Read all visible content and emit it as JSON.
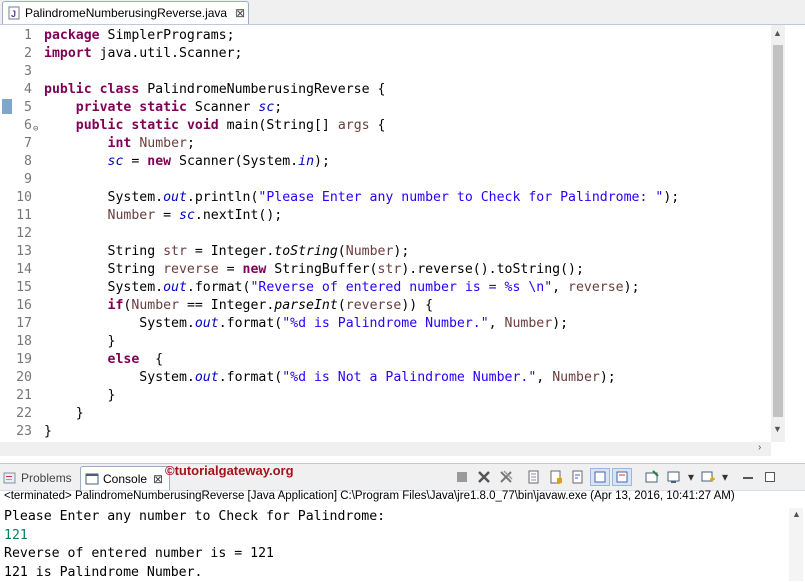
{
  "editor_tab": {
    "title": "PalindromeNumberusingReverse.java",
    "close_glyph": "⊠",
    "icon": "java-file-icon"
  },
  "code_lines": [
    {
      "n": "1",
      "parts": [
        [
          "kw",
          "package"
        ],
        [
          "",
          " SimplerPrograms;"
        ]
      ]
    },
    {
      "n": "2",
      "parts": [
        [
          "kw",
          "import"
        ],
        [
          "",
          " java.util.Scanner;"
        ]
      ]
    },
    {
      "n": "3",
      "parts": []
    },
    {
      "n": "4",
      "parts": [
        [
          "kw",
          "public"
        ],
        [
          "",
          " "
        ],
        [
          "kw",
          "class"
        ],
        [
          "",
          " PalindromeNumberusingReverse {"
        ]
      ]
    },
    {
      "n": "5",
      "parts": [
        [
          "",
          "    "
        ],
        [
          "kw",
          "private"
        ],
        [
          "",
          " "
        ],
        [
          "kw",
          "static"
        ],
        [
          "",
          " Scanner "
        ],
        [
          "sfld",
          "sc"
        ],
        [
          "",
          ";"
        ]
      ]
    },
    {
      "n": "6",
      "parts": [
        [
          "",
          "    "
        ],
        [
          "kw",
          "public"
        ],
        [
          "",
          " "
        ],
        [
          "kw",
          "static"
        ],
        [
          "",
          " "
        ],
        [
          "kw",
          "void"
        ],
        [
          "",
          " main(String[] "
        ],
        [
          "var",
          "args"
        ],
        [
          "",
          " {"
        ]
      ]
    },
    {
      "n": "7",
      "parts": [
        [
          "",
          "        "
        ],
        [
          "kw",
          "int"
        ],
        [
          "",
          " "
        ],
        [
          "var",
          "Number"
        ],
        [
          "",
          ";"
        ]
      ]
    },
    {
      "n": "8",
      "parts": [
        [
          "",
          "        "
        ],
        [
          "sfld",
          "sc"
        ],
        [
          "",
          " = "
        ],
        [
          "kw",
          "new"
        ],
        [
          "",
          " Scanner(System."
        ],
        [
          "sfld",
          "in"
        ],
        [
          "",
          ");"
        ]
      ]
    },
    {
      "n": "9",
      "parts": []
    },
    {
      "n": "10",
      "parts": [
        [
          "",
          "        System."
        ],
        [
          "sfld",
          "out"
        ],
        [
          "",
          ".println("
        ],
        [
          "str",
          "\"Please Enter any number to Check for Palindrome: \""
        ],
        [
          "",
          ");"
        ]
      ]
    },
    {
      "n": "11",
      "parts": [
        [
          "",
          "        "
        ],
        [
          "var",
          "Number"
        ],
        [
          "",
          " = "
        ],
        [
          "sfld",
          "sc"
        ],
        [
          "",
          ".nextInt();"
        ]
      ]
    },
    {
      "n": "12",
      "parts": []
    },
    {
      "n": "13",
      "parts": [
        [
          "",
          "        String "
        ],
        [
          "var",
          "str"
        ],
        [
          "",
          " = Integer."
        ],
        [
          "smeth",
          "toString"
        ],
        [
          "",
          "("
        ],
        [
          "var",
          "Number"
        ],
        [
          "",
          ");"
        ]
      ]
    },
    {
      "n": "14",
      "parts": [
        [
          "",
          "        String "
        ],
        [
          "var",
          "reverse"
        ],
        [
          "",
          " = "
        ],
        [
          "kw",
          "new"
        ],
        [
          "",
          " StringBuffer("
        ],
        [
          "var",
          "str"
        ],
        [
          "",
          ").reverse().toString();"
        ]
      ]
    },
    {
      "n": "15",
      "parts": [
        [
          "",
          "        System."
        ],
        [
          "sfld",
          "out"
        ],
        [
          "",
          ".format("
        ],
        [
          "str",
          "\"Reverse of entered number is = %s \\n\""
        ],
        [
          "",
          ", "
        ],
        [
          "var",
          "reverse"
        ],
        [
          "",
          ");"
        ]
      ]
    },
    {
      "n": "16",
      "parts": [
        [
          "",
          "        "
        ],
        [
          "kw",
          "if"
        ],
        [
          "",
          "("
        ],
        [
          "var",
          "Number"
        ],
        [
          "",
          " == Integer."
        ],
        [
          "smeth",
          "parseInt"
        ],
        [
          "",
          "("
        ],
        [
          "var",
          "reverse"
        ],
        [
          "",
          ")) {"
        ]
      ]
    },
    {
      "n": "17",
      "parts": [
        [
          "",
          "            System."
        ],
        [
          "sfld",
          "out"
        ],
        [
          "",
          ".format("
        ],
        [
          "str",
          "\"%d is Palindrome Number.\""
        ],
        [
          "",
          ", "
        ],
        [
          "var",
          "Number"
        ],
        [
          "",
          ");"
        ]
      ]
    },
    {
      "n": "18",
      "parts": [
        [
          "",
          "        }"
        ]
      ]
    },
    {
      "n": "19",
      "parts": [
        [
          "",
          "        "
        ],
        [
          "kw",
          "else"
        ],
        [
          "",
          "  {"
        ]
      ]
    },
    {
      "n": "20",
      "parts": [
        [
          "",
          "            System."
        ],
        [
          "sfld",
          "out"
        ],
        [
          "",
          ".format("
        ],
        [
          "str",
          "\"%d is Not a Palindrome Number.\""
        ],
        [
          "",
          ", "
        ],
        [
          "var",
          "Number"
        ],
        [
          "",
          ");"
        ]
      ]
    },
    {
      "n": "21",
      "parts": [
        [
          "",
          "        }"
        ]
      ]
    },
    {
      "n": "22",
      "parts": [
        [
          "",
          "    }"
        ]
      ]
    },
    {
      "n": "23",
      "parts": [
        [
          "",
          "}"
        ]
      ]
    }
  ],
  "bottom_panel": {
    "problems_label": "Problems",
    "console_label": "Console",
    "console_close": "⊠",
    "watermark": "©tutorialgateway.org",
    "status": "<terminated> PalindromeNumberusingReverse [Java Application] C:\\Program Files\\Java\\jre1.8.0_77\\bin\\javaw.exe (Apr 13, 2016, 10:41:27 AM)",
    "output": [
      {
        "text": "Please Enter any number to Check for Palindrome:",
        "input": false
      },
      {
        "text": "121",
        "input": true
      },
      {
        "text": "Reverse of entered number is = 121",
        "input": false
      },
      {
        "text": "121 is Palindrome Number.",
        "input": false
      }
    ]
  },
  "colors": {
    "keyword": "#7f0055",
    "string": "#2a00ff",
    "field": "#0000c0",
    "variable": "#6a3e3e",
    "watermark": "#a4141e"
  }
}
